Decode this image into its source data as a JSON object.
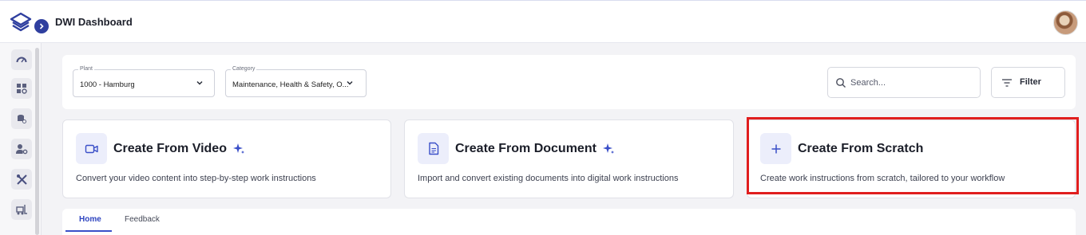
{
  "app": {
    "title": "DWI Dashboard"
  },
  "header": {
    "expand_icon": "chevron-right-icon",
    "logo_icon": "layers-logo-icon",
    "avatar": "user-avatar"
  },
  "sidebar": {
    "items": [
      {
        "name": "dashboard-gauge",
        "icon": "gauge-icon"
      },
      {
        "name": "apps-settings",
        "icon": "grid-gear-icon"
      },
      {
        "name": "database-settings",
        "icon": "database-gear-icon"
      },
      {
        "name": "user-settings",
        "icon": "user-gear-icon"
      },
      {
        "name": "tools",
        "icon": "tools-icon"
      },
      {
        "name": "forklift",
        "icon": "forklift-icon"
      }
    ]
  },
  "filters": {
    "plant": {
      "label": "Plant",
      "value": "1000 - Hamburg"
    },
    "category": {
      "label": "Category",
      "value": "Maintenance, Health & Safety, O..."
    },
    "search": {
      "placeholder": "Search..."
    },
    "filter_button": "Filter"
  },
  "cards": [
    {
      "title": "Create From Video",
      "description": "Convert your video content into step-by-step work instructions",
      "icon": "video-camera-icon",
      "ai": true
    },
    {
      "title": "Create From Document",
      "description": "Import and convert existing documents into digital work instructions",
      "icon": "document-icon",
      "ai": true
    },
    {
      "title": "Create From Scratch",
      "description": "Create work instructions from scratch, tailored to your workflow",
      "icon": "plus-icon",
      "ai": false,
      "highlighted": true
    }
  ],
  "tabs": [
    {
      "label": "Home",
      "active": true
    },
    {
      "label": "Feedback",
      "active": false
    }
  ],
  "colors": {
    "accent": "#3a4fc8",
    "highlight": "#e01e1e",
    "icon_bg": "#eceefb",
    "spark": "#3a4fc8"
  }
}
